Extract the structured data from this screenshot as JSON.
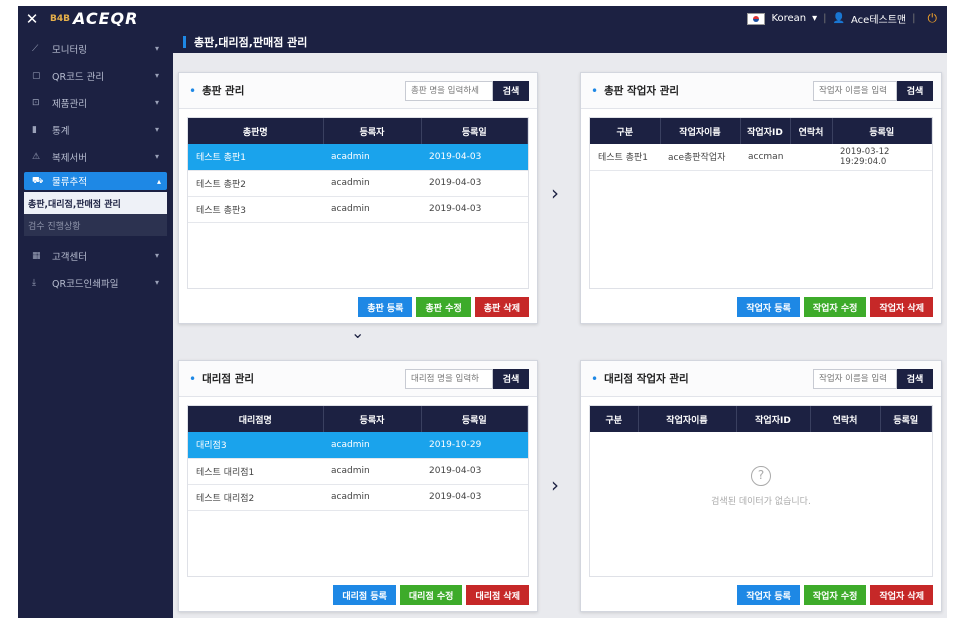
{
  "header": {
    "close_glyph": "✕",
    "logo_prefix": "B4B",
    "logo": "ACEQR",
    "language": "Korean",
    "user": "Ace테스트맨"
  },
  "sidebar": {
    "items": [
      {
        "label": "모니터링",
        "icon": "chart-icon"
      },
      {
        "label": "QR코드 관리",
        "icon": "qr-icon"
      },
      {
        "label": "제품관리",
        "icon": "box-icon"
      },
      {
        "label": "통계",
        "icon": "bar-chart-icon"
      },
      {
        "label": "복제서버",
        "icon": "warning-icon"
      },
      {
        "label": "물류추적",
        "icon": "truck-icon"
      },
      {
        "label": "고객센터",
        "icon": "support-icon"
      },
      {
        "label": "QR코드인쇄파일",
        "icon": "download-icon"
      }
    ],
    "submenu": [
      "총판,대리점,판매점 관리",
      "검수 진행상황"
    ]
  },
  "page": {
    "title": "총판,대리점,판매점 관리"
  },
  "distributor": {
    "title": "총판 관리",
    "search_placeholder": "총판 명을 입력하세",
    "search_label": "검색",
    "columns": [
      "총판명",
      "등록자",
      "등록일"
    ],
    "rows": [
      [
        "테스트 총판1",
        "acadmin",
        "2019-04-03"
      ],
      [
        "테스트 총판2",
        "acadmin",
        "2019-04-03"
      ],
      [
        "테스트 총판3",
        "acadmin",
        "2019-04-03"
      ]
    ],
    "buttons": {
      "add": "총판 등록",
      "edit": "총판 수정",
      "delete": "총판 삭제"
    }
  },
  "distributor_workers": {
    "title": "총판 작업자 관리",
    "search_placeholder": "작업자 이름을 입력",
    "search_label": "검색",
    "columns": [
      "구분",
      "작업자이름",
      "작업자ID",
      "연락처",
      "등록일"
    ],
    "rows": [
      [
        "테스트 총판1",
        "ace총판작업자",
        "accman",
        "",
        "2019-03-12 19:29:04.0"
      ]
    ],
    "buttons": {
      "add": "작업자 등록",
      "edit": "작업자 수정",
      "delete": "작업자 삭제"
    }
  },
  "agency": {
    "title": "대리점 관리",
    "search_placeholder": "대리점 명을 입력하",
    "search_label": "검색",
    "columns": [
      "대리점명",
      "등록자",
      "등록일"
    ],
    "rows": [
      [
        "대리점3",
        "acadmin",
        "2019-10-29"
      ],
      [
        "테스트 대리점1",
        "acadmin",
        "2019-04-03"
      ],
      [
        "테스트 대리점2",
        "acadmin",
        "2019-04-03"
      ]
    ],
    "buttons": {
      "add": "대리점 등록",
      "edit": "대리점 수정",
      "delete": "대리점 삭제"
    }
  },
  "agency_workers": {
    "title": "대리점 작업자 관리",
    "search_placeholder": "작업자 이름을 입력",
    "search_label": "검색",
    "columns": [
      "구분",
      "작업자이름",
      "작업자ID",
      "연락처",
      "등록일"
    ],
    "empty_text": "검색된 데이터가 없습니다.",
    "buttons": {
      "add": "작업자 등록",
      "edit": "작업자 수정",
      "delete": "작업자 삭제"
    }
  }
}
